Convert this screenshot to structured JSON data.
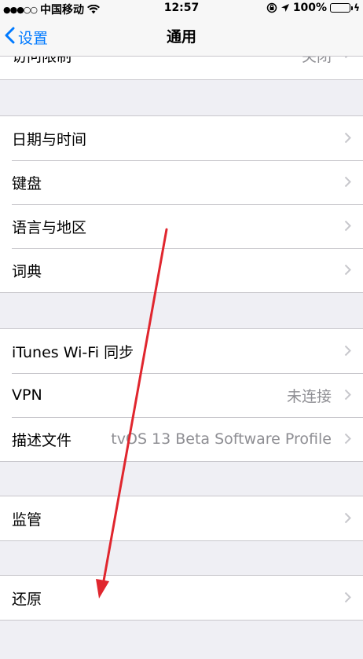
{
  "status_bar": {
    "signal": "●●●○○",
    "carrier": "中国移动",
    "time": "12:57",
    "battery_percent": "100%"
  },
  "nav": {
    "back_label": "设置",
    "title": "通用"
  },
  "cut_row": {
    "label": "访问限制",
    "value": "关闭"
  },
  "groups": [
    {
      "rows": [
        {
          "label": "日期与时间"
        },
        {
          "label": "键盘"
        },
        {
          "label": "语言与地区"
        },
        {
          "label": "词典"
        }
      ]
    },
    {
      "rows": [
        {
          "label": "iTunes Wi-Fi 同步"
        },
        {
          "label": "VPN",
          "value": "未连接"
        },
        {
          "label": "描述文件",
          "value": "tvOS 13 Beta Software Profile"
        }
      ]
    },
    {
      "rows": [
        {
          "label": "监管"
        }
      ]
    },
    {
      "rows": [
        {
          "label": "还原"
        }
      ]
    }
  ],
  "colors": {
    "accent": "#007aff",
    "background": "#efeff4",
    "battery": "#4cd964",
    "annotation": "#e0262e"
  },
  "icons": [
    "wifi-icon",
    "lock-rotation-icon",
    "location-icon",
    "battery-icon",
    "charging-icon",
    "back-chevron-icon",
    "chevron-right-icon"
  ]
}
